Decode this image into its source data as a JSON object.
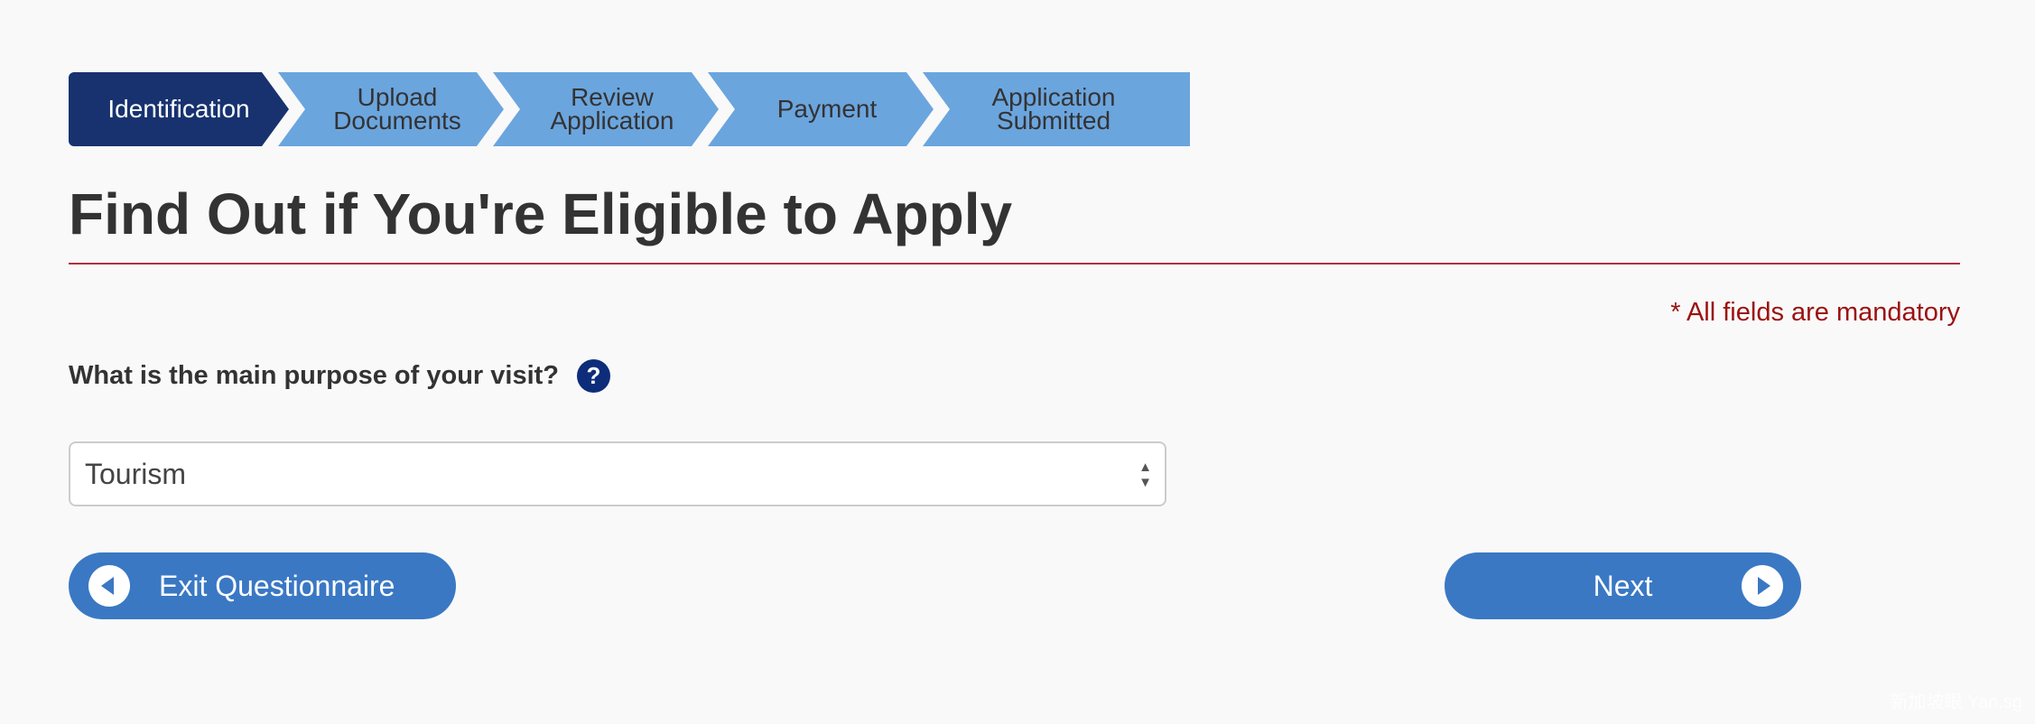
{
  "stepper": {
    "steps": [
      {
        "label": "Identification",
        "active": true
      },
      {
        "label": "Upload\nDocuments",
        "active": false
      },
      {
        "label": "Review\nApplication",
        "active": false
      },
      {
        "label": "Payment",
        "active": false
      },
      {
        "label": "Application\nSubmitted",
        "active": false
      }
    ]
  },
  "page": {
    "title": "Find Out if You're Eligible to Apply",
    "mandatory_note": "* All fields are mandatory"
  },
  "form": {
    "question": "What is the main purpose of your visit?",
    "help_icon": "?",
    "purpose_select": {
      "value": "Tourism"
    }
  },
  "buttons": {
    "exit_label": "Exit Questionnaire",
    "next_label": "Next"
  },
  "watermark": "新加坡眼 Yan.sg",
  "colors": {
    "active_step": "#17326f",
    "step": "#6ba5de",
    "button": "#3a78c4",
    "mandatory": "#9b1111",
    "rule": "#b03040"
  }
}
